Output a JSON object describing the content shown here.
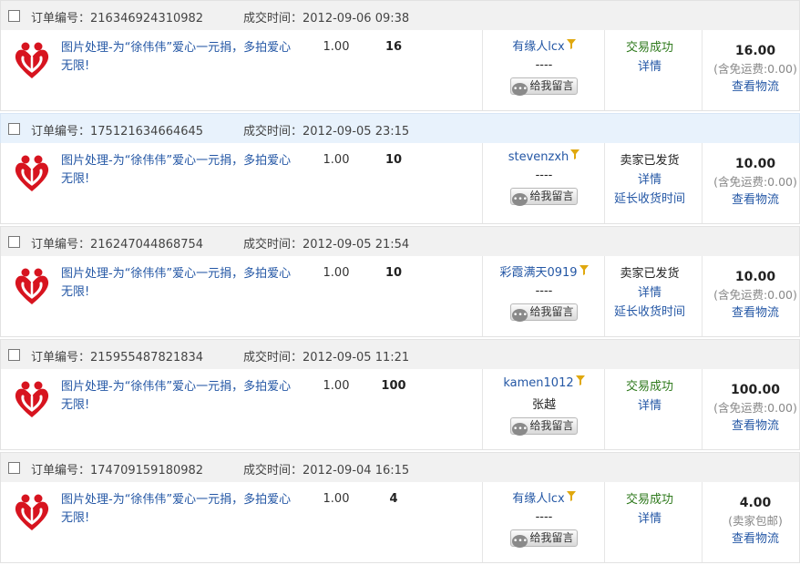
{
  "labels": {
    "order_no_prefix": "订单编号：",
    "deal_time_prefix": "成交时间：",
    "msg_button": "给我留言",
    "view_details": "详情",
    "view_logistics": "查看物流",
    "extend_receipt": "延长收货时间"
  },
  "colors": {
    "link": "#2457a5",
    "success": "#2f7a1d",
    "header_bg": "#f1f1f1",
    "header_highlight_bg": "#e8f2fc",
    "logo_red": "#d7141f"
  },
  "icons": {
    "logo": "heart-charity-logo",
    "filter": "funnel-icon",
    "message": "message-bubble-icon"
  },
  "orders": [
    {
      "order_no": "21634692431098​2",
      "deal_time": "2012-09-06 09:38",
      "title": "图片处理-为“徐伟伟”爱心一元捐，多拍爱心无限!",
      "price": "1.00",
      "qty": "16",
      "buyer": "有缘人lcx",
      "buyer_sub": "----",
      "status": "交易成功",
      "status_type": "ok",
      "amount": "16.00",
      "amount_note": "(含免运费:0.00)",
      "extend": ""
    },
    {
      "order_no": "175121634664645",
      "deal_time": "2012-09-05 23:15",
      "title": "图片处理-为“徐伟伟”爱心一元捐，多拍爱心无限!",
      "price": "1.00",
      "qty": "10",
      "buyer": "stevenzxh",
      "buyer_sub": "----",
      "status": "卖家已发货",
      "status_type": "ship",
      "amount": "10.00",
      "amount_note": "(含免运费:0.00)",
      "extend": "延长收货时间"
    },
    {
      "order_no": "216247044868754",
      "deal_time": "2012-09-05 21:54",
      "title": "图片处理-为“徐伟伟”爱心一元捐，多拍爱心无限!",
      "price": "1.00",
      "qty": "10",
      "buyer": "彩霞满天0919",
      "buyer_sub": "----",
      "status": "卖家已发货",
      "status_type": "ship",
      "amount": "10.00",
      "amount_note": "(含免运费:0.00)",
      "extend": "延长收货时间"
    },
    {
      "order_no": "215955487821834",
      "deal_time": "2012-09-05 11:21",
      "title": "图片处理-为“徐伟伟”爱心一元捐，多拍爱心无限!",
      "price": "1.00",
      "qty": "100",
      "buyer": "kamen1012",
      "buyer_sub": "张越",
      "status": "交易成功",
      "status_type": "ok",
      "amount": "100.00",
      "amount_note": "(含免运费:0.00)",
      "extend": ""
    },
    {
      "order_no": "174709159180982",
      "deal_time": "2012-09-04 16:15",
      "title": "图片处理-为“徐伟伟”爱心一元捐，多拍爱心无限!",
      "price": "1.00",
      "qty": "4",
      "buyer": "有缘人lcx",
      "buyer_sub": "----",
      "status": "交易成功",
      "status_type": "ok",
      "amount": "4.00",
      "amount_note": "(卖家包邮)",
      "extend": ""
    }
  ]
}
